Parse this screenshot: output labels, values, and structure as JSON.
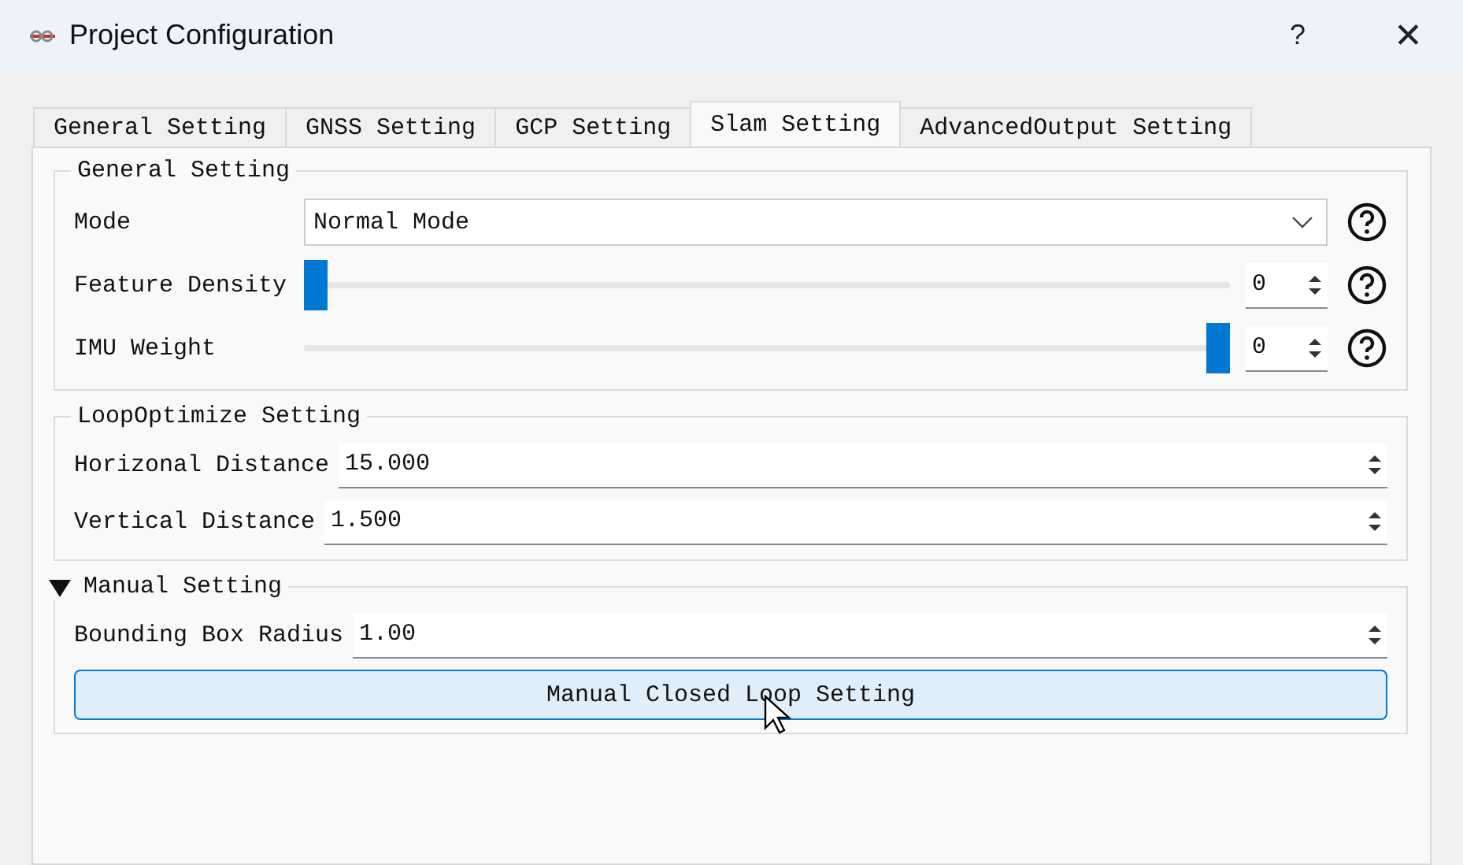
{
  "window": {
    "title": "Project Configuration",
    "help": "?",
    "close": "✕"
  },
  "tabs": [
    {
      "label": "General Setting",
      "selected": false
    },
    {
      "label": "GNSS Setting",
      "selected": false
    },
    {
      "label": "GCP Setting",
      "selected": false
    },
    {
      "label": "Slam Setting",
      "selected": true
    },
    {
      "label": "AdvancedOutput Setting",
      "selected": false
    }
  ],
  "general_setting": {
    "title": "General Setting",
    "rows": [
      {
        "kind": "dropdown",
        "label": "Mode",
        "value": "Normal Mode"
      },
      {
        "kind": "slider",
        "label": "Feature Density",
        "level": 0,
        "value": "0"
      },
      {
        "kind": "slider",
        "label": "IMU Weight",
        "level": 1,
        "value": "0"
      }
    ]
  },
  "loop_optimize_setting": {
    "title": "LoopOptimize Setting",
    "rows": [
      {
        "label": "Horizonal Distance",
        "value": "15.000"
      },
      {
        "label": "Vertical Distance",
        "value": "1.500"
      }
    ]
  },
  "manual_setting": {
    "title": "Manual Setting",
    "expanded": true,
    "rows": [
      {
        "label": "Bounding Box Radius",
        "value": "1.00"
      }
    ],
    "button": "Manual Closed Loop Setting"
  }
}
